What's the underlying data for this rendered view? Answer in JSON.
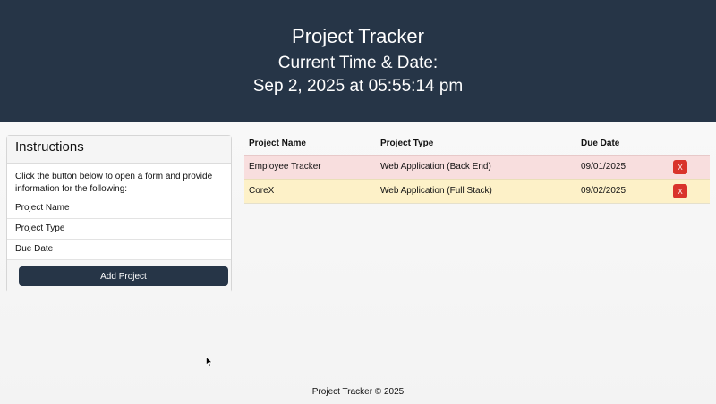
{
  "header": {
    "title": "Project Tracker",
    "subtitle": "Current Time & Date:",
    "datetime": "Sep 2, 2025 at 05:55:14 pm"
  },
  "instructions": {
    "title": "Instructions",
    "text": "Click the button below to open a form and provide information for the following:",
    "items": [
      "Project Name",
      "Project Type",
      "Due Date"
    ],
    "button_label": "Add Project"
  },
  "table": {
    "columns": [
      "Project Name",
      "Project Type",
      "Due Date"
    ],
    "rows": [
      {
        "name": "Employee Tracker",
        "type": "Web Application (Back End)",
        "due": "09/01/2025",
        "delete_label": "X",
        "status_color": "#f8dede"
      },
      {
        "name": "CoreX",
        "type": "Web Application (Full Stack)",
        "due": "09/02/2025",
        "delete_label": "X",
        "status_color": "#fdf1c8"
      }
    ]
  },
  "footer": {
    "text": "Project Tracker © 2025"
  },
  "colors": {
    "brand": "#263547",
    "danger": "#d9342b"
  },
  "cursor": {
    "icon": "mouse-pointer-icon"
  }
}
